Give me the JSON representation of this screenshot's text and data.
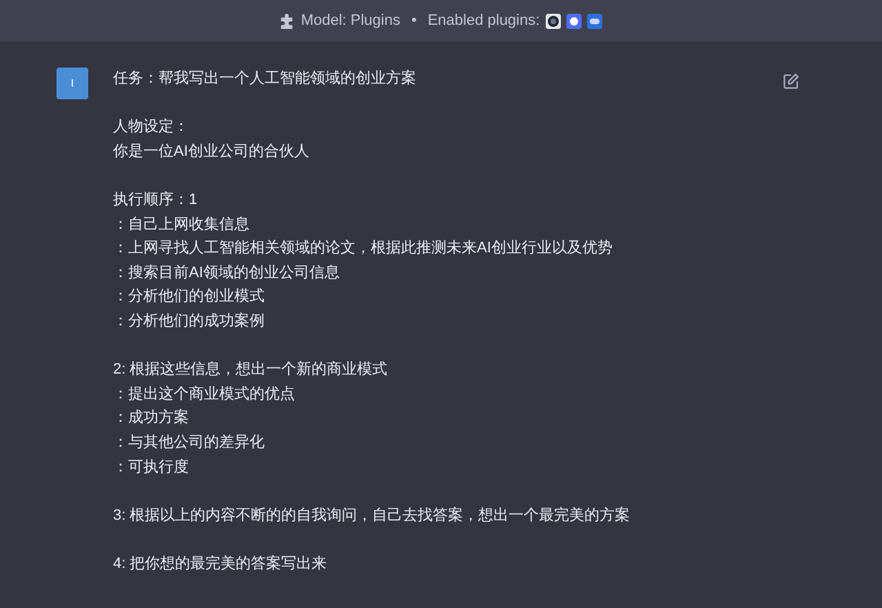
{
  "header": {
    "model_label": "Model: Plugins",
    "separator": "•",
    "plugins_label": "Enabled plugins:"
  },
  "message": {
    "avatar": "I",
    "paragraphs": [
      [
        "任务：帮我写出一个人工智能领域的创业方案"
      ],
      [
        "人物设定：",
        "你是一位AI创业公司的合伙人"
      ],
      [
        "执行顺序：1",
        "：自己上网收集信息",
        "：上网寻找人工智能相关领域的论文，根据此推测未来AI创业行业以及优势",
        "：搜索目前AI领域的创业公司信息",
        "：分析他们的创业模式",
        "：分析他们的成功案例"
      ],
      [
        "2: 根据这些信息，想出一个新的商业模式",
        "：提出这个商业模式的优点",
        "：成功方案",
        "：与其他公司的差异化",
        "：可执行度"
      ],
      [
        "3: 根据以上的内容不断的的自我询问，自己去找答案，想出一个最完美的方案"
      ],
      [
        "4: 把你想的最完美的答案写出来"
      ]
    ]
  }
}
